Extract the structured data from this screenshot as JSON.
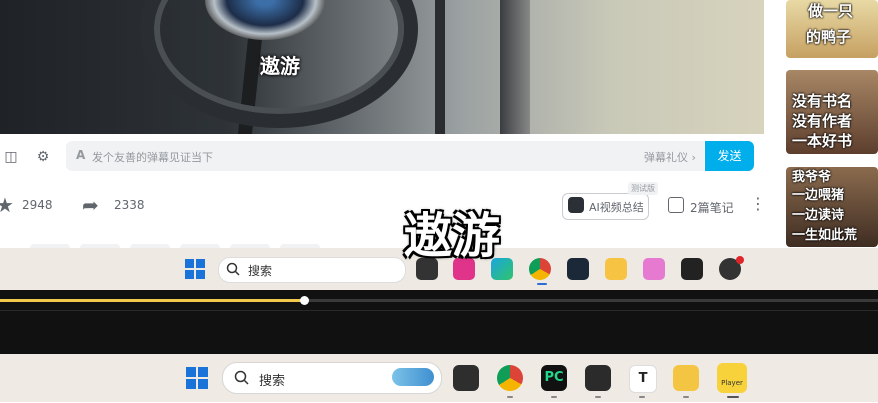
{
  "video": {
    "caption": "遨游"
  },
  "danmaku": {
    "placeholder": "发个友善的弹幕见证当下",
    "etiquette": "弹幕礼仪 ›",
    "send_label": "发送",
    "font_icon_label": "A"
  },
  "actions": {
    "favorite_count": "2948",
    "share_count": "2338",
    "ai_summary_label": "AI视频总结",
    "beta_tag": "测试版",
    "notes_label": "2篇笔记"
  },
  "right_rail": {
    "thumb1_lines": [
      "做一只",
      "的鸭子"
    ],
    "thumb2_lines": [
      "没有书名",
      "没有作者",
      "一本好书"
    ],
    "thumb3_lines": [
      "我爷爷",
      "一边喂猪",
      "一边读诗",
      "一生如此荒"
    ]
  },
  "subtitle_overlay": "遨游",
  "inner_taskbar": {
    "search_label": "搜索",
    "icons": [
      "windows-start-icon",
      "task-view-icon",
      "app-pink-icon",
      "edge-icon",
      "chrome-icon",
      "steam-icon",
      "file-explorer-icon",
      "cat-app-icon",
      "terminal-icon",
      "davinci-icon"
    ]
  },
  "player": {
    "progress": 0.346
  },
  "outer_taskbar": {
    "search_label": "搜索",
    "icons": [
      "windows-start-icon",
      "task-view-icon",
      "chrome-icon",
      "pycharm-icon",
      "terminal-icon",
      "typora-icon",
      "file-explorer-icon",
      "potplayer-icon"
    ],
    "pycharm_label": "PC",
    "typora_label": "T",
    "player_label": "Player"
  },
  "colors": {
    "accent": "#00aeec",
    "progress": "#f2c94c"
  }
}
